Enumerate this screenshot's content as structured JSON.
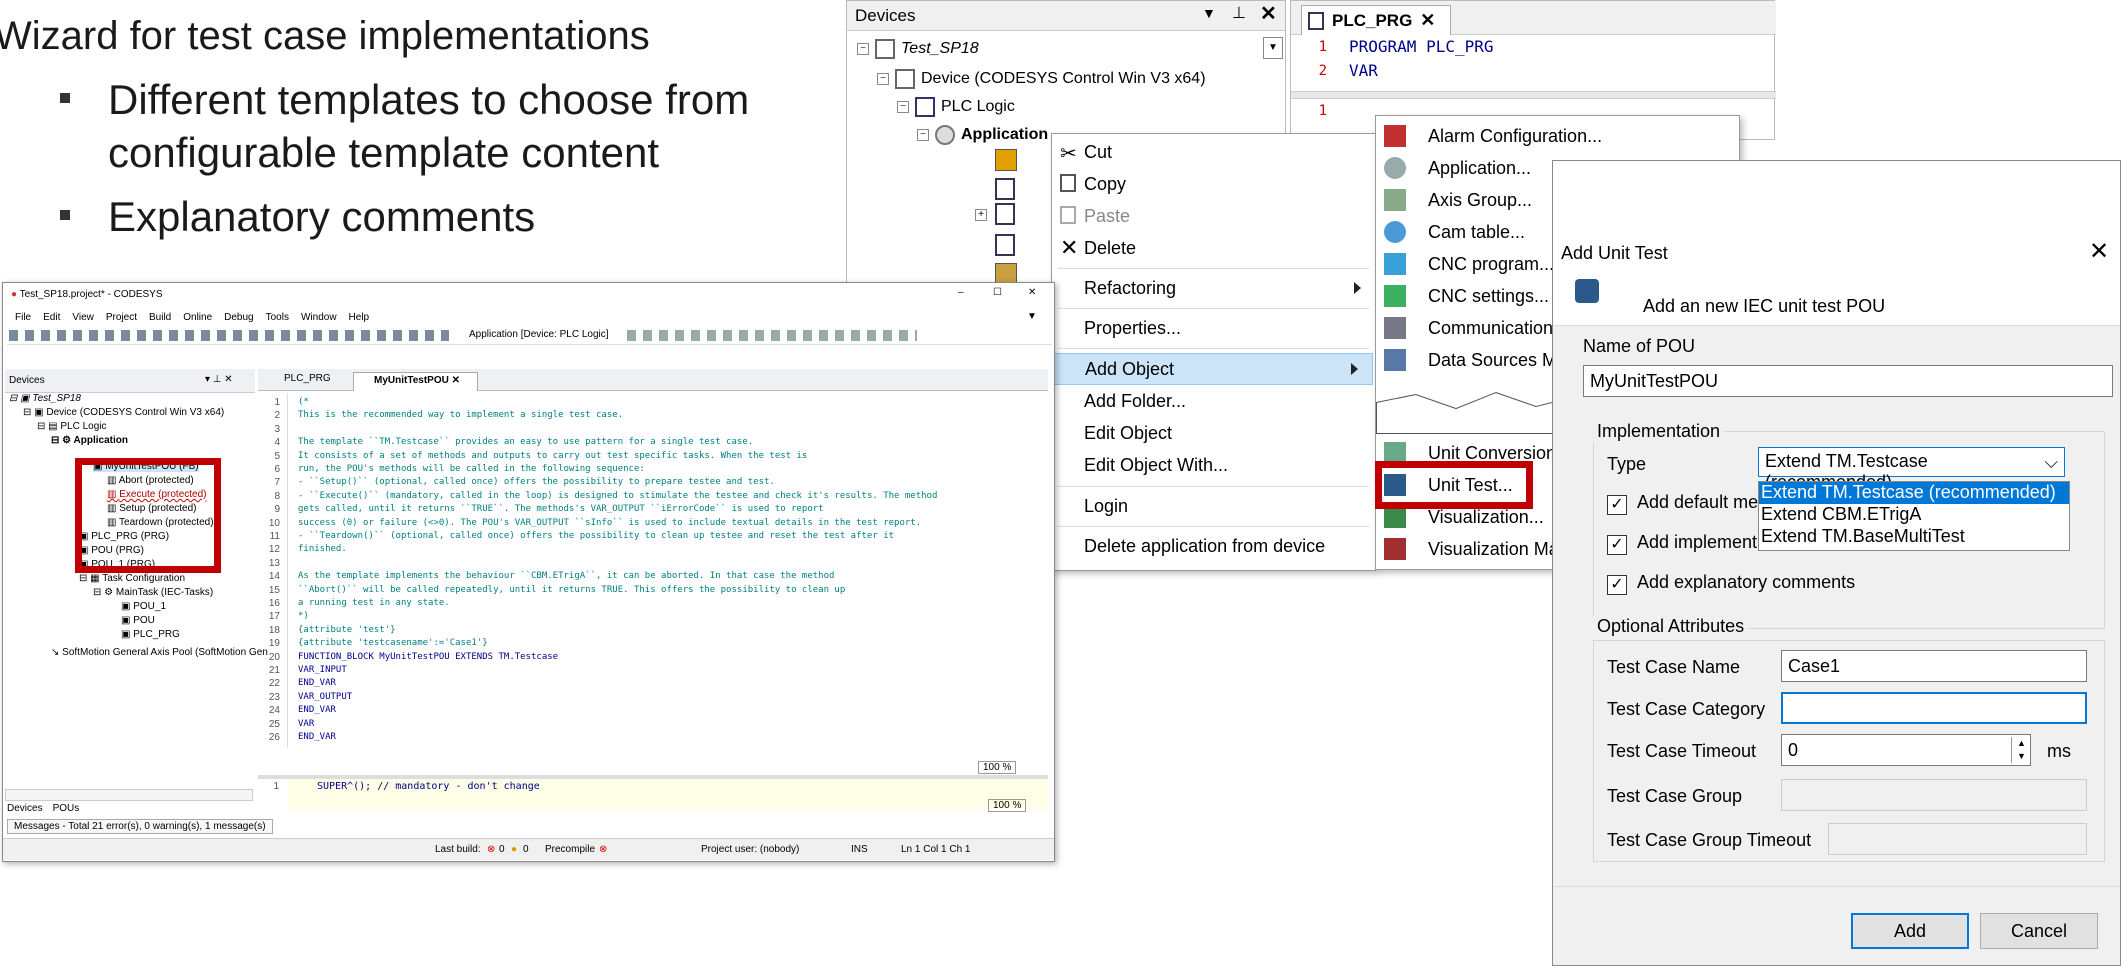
{
  "slide": {
    "title": "Wizard for test case implementations",
    "bullets": [
      "Different templates to choose from",
      "configurable template content",
      "Explanatory comments"
    ]
  },
  "devices_panel": {
    "title": "Devices",
    "tree": [
      "Test_SP18",
      "Device (CODESYS Control Win V3 x64)",
      "PLC Logic",
      "Application"
    ]
  },
  "editor_top": {
    "tab": "PLC_PRG",
    "lines": [
      {
        "n": "1",
        "text": "PROGRAM PLC_PRG"
      },
      {
        "n": "2",
        "text": "VAR"
      }
    ],
    "bottom_num": "1"
  },
  "context_menu": {
    "items": [
      "Cut",
      "Copy",
      "Paste",
      "Delete",
      "Refactoring",
      "Properties...",
      "Add Object",
      "Add Folder...",
      "Edit Object",
      "Edit Object With...",
      "Login",
      "Delete application from device"
    ]
  },
  "add_object_menu": {
    "items": [
      "Alarm Configuration...",
      "Application...",
      "Axis Group...",
      "Cam table...",
      "CNC program...",
      "CNC settings...",
      "Communication",
      "Data Sources Ma",
      "Unit Conversion.",
      "Unit Test...",
      "Visualization...",
      "Visualization Ma"
    ]
  },
  "dialog": {
    "title": "Add Unit Test",
    "subtitle": "Add an new IEC unit test POU",
    "name_label": "Name of POU",
    "name_value": "MyUnitTestPOU",
    "impl_group": "Implementation",
    "type_label": "Type",
    "type_value": "Extend TM.Testcase (recommended)",
    "type_options": [
      "Extend TM.Testcase (recommended)",
      "Extend CBM.ETrigA",
      "Extend TM.BaseMultiTest"
    ],
    "check1": "Add default me",
    "check2": "Add implement",
    "check3": "Add explanatory comments",
    "opt_group": "Optional Attributes",
    "tc_name_label": "Test Case Name",
    "tc_name_value": "Case1",
    "tc_cat_label": "Test Case Category",
    "tc_cat_value": "",
    "tc_timeout_label": "Test Case Timeout",
    "tc_timeout_value": "0",
    "tc_timeout_unit": "ms",
    "tc_group_label": "Test Case Group",
    "tc_group_timeout_label": "Test Case Group Timeout",
    "add_button": "Add",
    "cancel_button": "Cancel"
  },
  "ide": {
    "window_title": "Test_SP18.project* - CODESYS",
    "menu": [
      "File",
      "Edit",
      "View",
      "Project",
      "Build",
      "Online",
      "Debug",
      "Tools",
      "Window",
      "Help"
    ],
    "toolbar_app": "Application [Device: PLC Logic]",
    "devices_title": "Devices",
    "tree": [
      "Test_SP18",
      "Device (CODESYS Control Win V3 x64)",
      "PLC Logic",
      "Application",
      "MyUnitTestPOU (FB)",
      "Abort (protected)",
      "Execute (protected)",
      "Setup (protected)",
      "Teardown (protected)",
      "PLC_PRG (PRG)",
      "POU (PRG)",
      "POU_1 (PRG)",
      "Task Configuration",
      "MainTask (IEC-Tasks)",
      "POU_1",
      "POU",
      "PLC_PRG",
      "SoftMotion General Axis Pool (SoftMotion Gen"
    ],
    "tabs": [
      "PLC_PRG",
      "MyUnitTestPOU"
    ],
    "code": [
      "(*",
      "    This is the recommended way to implement a single test case.",
      "",
      "    The template ``TM.Testcase`` provides an easy to use pattern for a single test case.",
      "    It consists of a set of methods and outputs to carry out test specific tasks. When the test is",
      "    run, the POU's methods will be called in the following sequence:",
      "    - ``Setup()`` (optional, called once) offers the possibility to prepare testee and test.",
      "    - ``Execute()`` (mandatory, called in the loop) is designed to stimulate the testee and check it's results. The method",
      "      gets called, until it returns  ``TRUE``. The methods's VAR_OUTPUT ``iErrorCode`` is used to report",
      "      success (0) or failure (<>0). The POU's VAR_OUTPUT ``sInfo`` is used to include textual details in the test report.",
      "    - ``Teardown()`` (optional, called once) offers the possibility to clean up testee and reset the test after it",
      "      finished.",
      "",
      "    As the template implements the behaviour ``CBM.ETrigA``, it can be aborted. In that case the method",
      "    ``Abort()`` will be called repeatedly, until it returns TRUE. This offers the possibility to clean up",
      "    a running test in any state.",
      "*)",
      "{attribute 'test'}",
      "{attribute 'testcasename':='Case1'}",
      "FUNCTION_BLOCK MyUnitTestPOU EXTENDS TM.Testcase",
      "VAR_INPUT",
      "END_VAR",
      "VAR_OUTPUT",
      "END_VAR",
      "VAR",
      "END_VAR"
    ],
    "zoom": "100 %",
    "bottom_code": "SUPER^();   // mandatory - don't change",
    "bottom_tabs": [
      "Devices",
      "POUs"
    ],
    "messages": "Messages - Total 21 error(s), 0 warning(s), 1 message(s)",
    "status": {
      "last_build": "Last build:",
      "errors": "0",
      "warnings": "0",
      "precompile": "Precompile",
      "user": "Project user: (nobody)",
      "ins": "INS",
      "pos": "Ln 1  Col 1  Ch 1"
    }
  },
  "colors": {
    "highlight_red": "#c00000",
    "menu_select": "#cce4f7",
    "code_teal": "#008080",
    "keyword_blue": "#0000ff"
  }
}
